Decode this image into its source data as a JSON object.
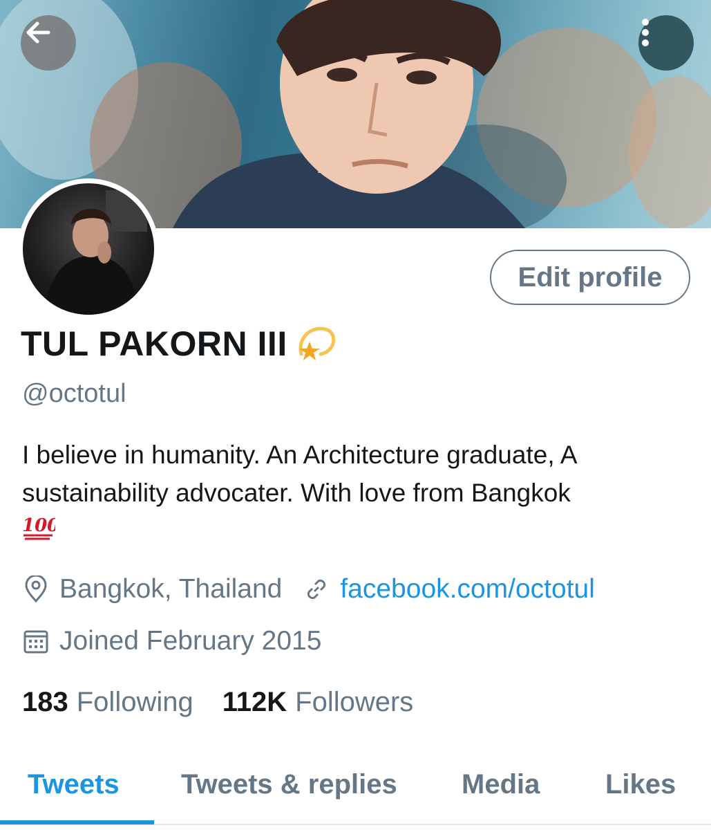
{
  "header": {
    "back_icon": "arrow-left-icon",
    "more_icon": "more-vertical-icon",
    "banner_colors": [
      "#2e6c86",
      "#8fc1cf"
    ]
  },
  "profile": {
    "name": "TUL PAKORN III",
    "name_emoji": "dizzy-star-icon",
    "handle": "@octotul",
    "edit_label": "Edit profile",
    "bio": "I believe in humanity. An Architecture graduate,  A sustainability advocater.  With love from Bangkok",
    "bio_emoji": "hundred-points-icon",
    "location": "Bangkok, Thailand",
    "website": "facebook.com/octotul",
    "joined": "Joined February 2015"
  },
  "stats": {
    "following_count": "183",
    "following_label": "Following",
    "followers_count": "112K",
    "followers_label": "Followers"
  },
  "tabs": [
    {
      "label": "Tweets",
      "active": true
    },
    {
      "label": "Tweets & replies",
      "active": false
    },
    {
      "label": "Media",
      "active": false
    },
    {
      "label": "Likes",
      "active": false
    }
  ],
  "colors": {
    "accent": "#1b95e0",
    "secondary_text": "#657786",
    "primary_text": "#14171a"
  }
}
